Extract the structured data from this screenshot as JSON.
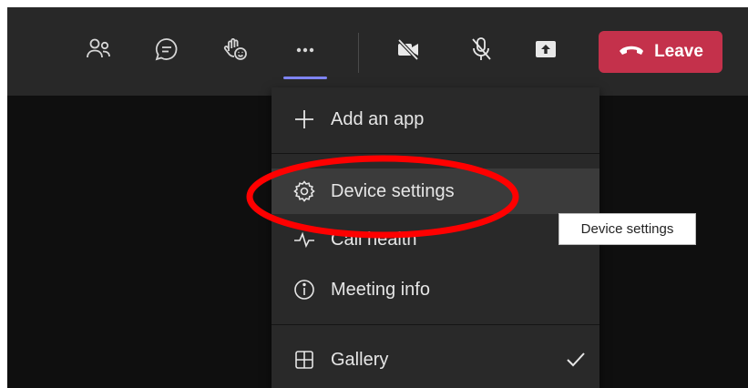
{
  "toolbar": {
    "buttons": [
      {
        "name": "people",
        "icon": "people-icon"
      },
      {
        "name": "chat",
        "icon": "chat-icon"
      },
      {
        "name": "react",
        "icon": "raise-hand-react-icon"
      },
      {
        "name": "more",
        "icon": "more-dots-icon",
        "active": true
      },
      {
        "name": "camera",
        "icon": "camera-off-icon"
      },
      {
        "name": "mic",
        "icon": "mic-off-icon"
      },
      {
        "name": "share",
        "icon": "share-tray-icon"
      }
    ],
    "leave_label": "Leave",
    "leave_color": "#c4314b",
    "accent_color": "#7f85f5"
  },
  "menu": {
    "items": [
      {
        "label": "Add an app",
        "icon": "plus-icon"
      },
      {
        "label": "Device settings",
        "icon": "gear-icon",
        "hovered": true
      },
      {
        "label": "Call health",
        "icon": "pulse-icon"
      },
      {
        "label": "Meeting info",
        "icon": "info-icon"
      },
      {
        "label": "Gallery",
        "icon": "grid-icon",
        "checked": true
      }
    ]
  },
  "tooltip": {
    "text": "Device settings"
  },
  "annotation": {
    "color": "#ff0000",
    "shape": "ellipse"
  }
}
